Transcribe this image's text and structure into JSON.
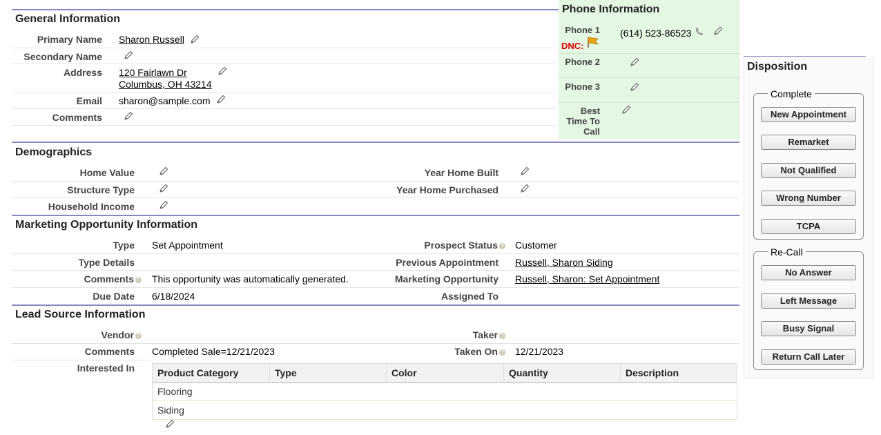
{
  "general": {
    "title": "General Information",
    "primary_name_label": "Primary Name",
    "primary_name": "Sharon Russell",
    "secondary_name_label": "Secondary Name",
    "address_label": "Address",
    "address_line1": "120 Fairlawn Dr",
    "address_line2": "Columbus, OH 43214",
    "email_label": "Email",
    "email": "sharon@sample.com",
    "comments_label": "Comments"
  },
  "phone": {
    "title": "Phone Information",
    "phone1_label": "Phone 1",
    "dnc_label": "DNC:",
    "phone1": "(614) 523-86523",
    "phone2_label": "Phone 2",
    "phone3_label": "Phone 3",
    "best_time_label1": "Best",
    "best_time_label2": "Time To",
    "best_time_label3": "Call"
  },
  "demographics": {
    "title": "Demographics",
    "home_value_label": "Home Value",
    "structure_type_label": "Structure Type",
    "household_income_label": "Household Income",
    "year_built_label": "Year Home Built",
    "year_purchased_label": "Year Home Purchased"
  },
  "marketing": {
    "title": "Marketing Opportunity Information",
    "type_label": "Type",
    "type": "Set Appointment",
    "type_details_label": "Type Details",
    "comments_label": "Comments",
    "comments": "This opportunity was automatically generated.",
    "due_date_label": "Due Date",
    "due_date": "6/18/2024",
    "prospect_status_label": "Prospect Status",
    "prospect_status": "Customer",
    "prev_appt_label": "Previous Appointment",
    "prev_appt": "Russell, Sharon Siding",
    "mkt_opp_label": "Marketing Opportunity",
    "mkt_opp": "Russell, Sharon: Set Appointment",
    "assigned_to_label": "Assigned To"
  },
  "lead": {
    "title": "Lead Source Information",
    "vendor_label": "Vendor",
    "comments_label": "Comments",
    "comments": "Completed Sale=12/21/2023",
    "interested_label": "Interested In",
    "taker_label": "Taker",
    "taken_on_label": "Taken On",
    "taken_on": "12/21/2023",
    "table_headers": [
      "Product Category",
      "Type",
      "Color",
      "Quantity",
      "Description"
    ],
    "table_rows": [
      [
        "Flooring",
        "",
        "",
        "",
        ""
      ],
      [
        "Siding",
        "",
        "",
        "",
        ""
      ]
    ]
  },
  "disposition": {
    "title": "Disposition",
    "complete_legend": "Complete",
    "recall_legend": "Re-Call",
    "buttons": [
      "New Appointment",
      "Remarket",
      "Not Qualified",
      "Wrong Number",
      "TCPA",
      "No Answer",
      "Left Message",
      "Busy Signal",
      "Return Call Later"
    ]
  },
  "colors": {
    "section_rule": "#8787c0",
    "phone_panel_bg": "#e3f7e3",
    "dnc_red": "#e00000",
    "flag_orange": "#e8a317"
  }
}
